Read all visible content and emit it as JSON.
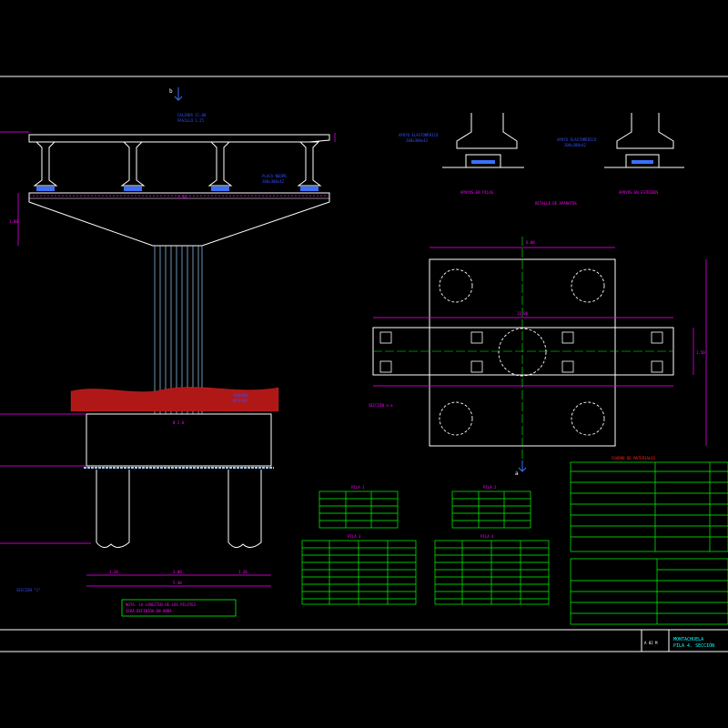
{
  "drawing": {
    "title_block": {
      "sheet_code": "A 02 M",
      "project_title": "MONTACHUELA",
      "sheet_subtitle": "PILA 4. SECCIÓN"
    },
    "view_markers": {
      "top": "b",
      "bottom": "a"
    },
    "plan_view_label": "SECCIÓN a-a",
    "detail_labels": [
      "APOYOS EN PILAS",
      "APOYOS EN ESTRIBOS"
    ],
    "section_caption": "DETALLE DE APARATOS",
    "tables": {
      "pile_tables": [
        "PILA 1",
        "PILA 2",
        "PILA 3",
        "PILA 4"
      ],
      "summary_title": "CUADRO DE MATERIALES",
      "summary_rows": 7,
      "notes_rows": 4
    },
    "colors": {
      "background": "#000000",
      "outline": "#ffffff",
      "dimension": "#ff00ff",
      "annotation": "#3050ff",
      "table": "#00ff00",
      "ground": "#ff2020",
      "title": "#00ffff",
      "pile": "#9ad0ff"
    }
  }
}
